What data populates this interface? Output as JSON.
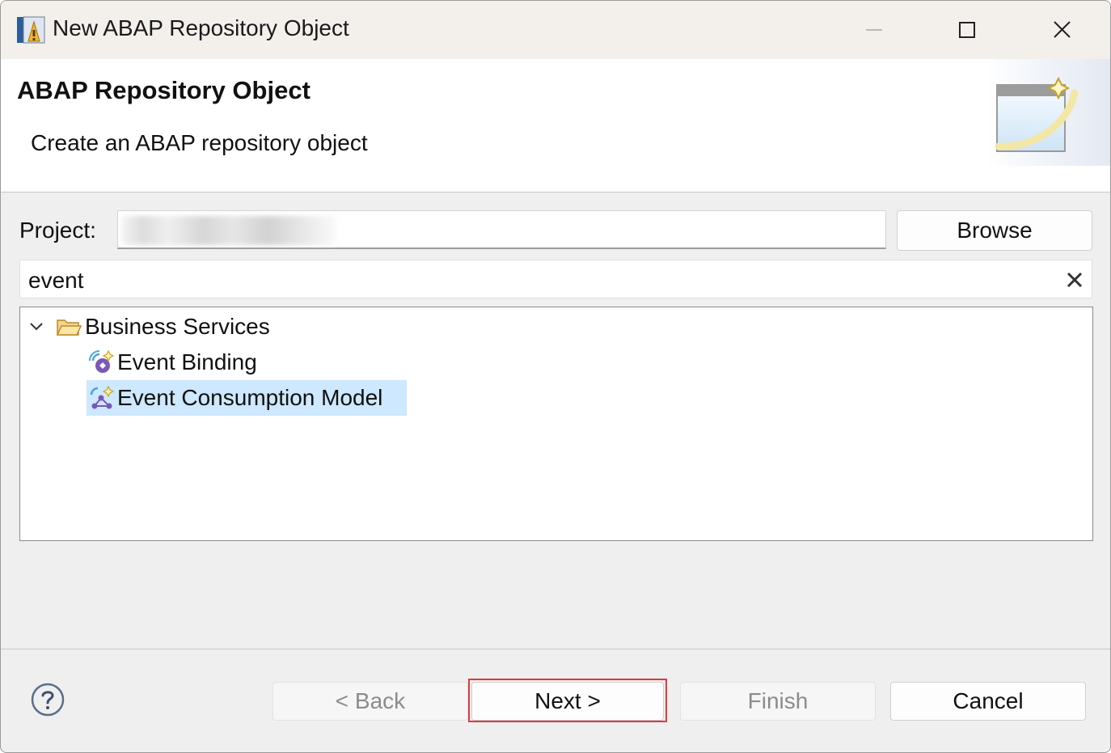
{
  "window": {
    "title": "New ABAP Repository Object"
  },
  "banner": {
    "title": "ABAP Repository Object",
    "description": "Create an ABAP repository object"
  },
  "project": {
    "label": "Project:",
    "value": "",
    "browse_label": "Browse"
  },
  "filter": {
    "value": "event"
  },
  "tree": {
    "folder": {
      "label": "Business Services",
      "expanded": true,
      "icon": "folder-open-icon"
    },
    "items": [
      {
        "label": "Event Binding",
        "icon": "event-binding-icon",
        "selected": false
      },
      {
        "label": "Event Consumption Model",
        "icon": "event-consumption-model-icon",
        "selected": true
      }
    ]
  },
  "footer": {
    "back_label": "< Back",
    "next_label": "Next >",
    "finish_label": "Finish",
    "cancel_label": "Cancel",
    "highlight_color": "#e0393e"
  },
  "colors": {
    "selection": "#cde8ff",
    "titlebar": "#f3f0ec",
    "dialog_bg": "#efefef"
  }
}
